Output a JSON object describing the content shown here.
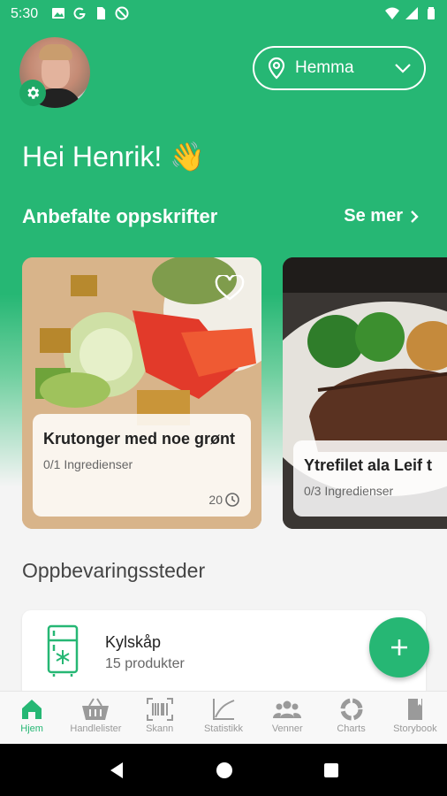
{
  "status_bar": {
    "time": "5:30"
  },
  "header": {
    "location_label": "Hemma",
    "greeting": "Hei Henrik! 👋"
  },
  "recipes": {
    "section_title": "Anbefalte oppskrifter",
    "see_more_label": "Se mer",
    "items": [
      {
        "title": "Krutonger med noe grønt",
        "ingredients": "0/1 Ingredienser",
        "time": "20"
      },
      {
        "title": "Ytrefilet ala Leif t",
        "ingredients": "0/3 Ingredienser"
      }
    ]
  },
  "storage": {
    "section_title": "Oppbevaringssteder",
    "items": [
      {
        "name": "Kylskåp",
        "count": "15 produkter"
      }
    ]
  },
  "bottom_nav": {
    "items": [
      {
        "label": "Hjem",
        "icon": "home-icon"
      },
      {
        "label": "Handlelister",
        "icon": "basket-icon"
      },
      {
        "label": "Skann",
        "icon": "barcode-icon"
      },
      {
        "label": "Statistikk",
        "icon": "chart-icon"
      },
      {
        "label": "Venner",
        "icon": "friends-icon"
      },
      {
        "label": "Charts",
        "icon": "donut-icon"
      },
      {
        "label": "Storybook",
        "icon": "book-icon"
      }
    ]
  },
  "colors": {
    "brand": "#26b774",
    "text": "#222222"
  }
}
